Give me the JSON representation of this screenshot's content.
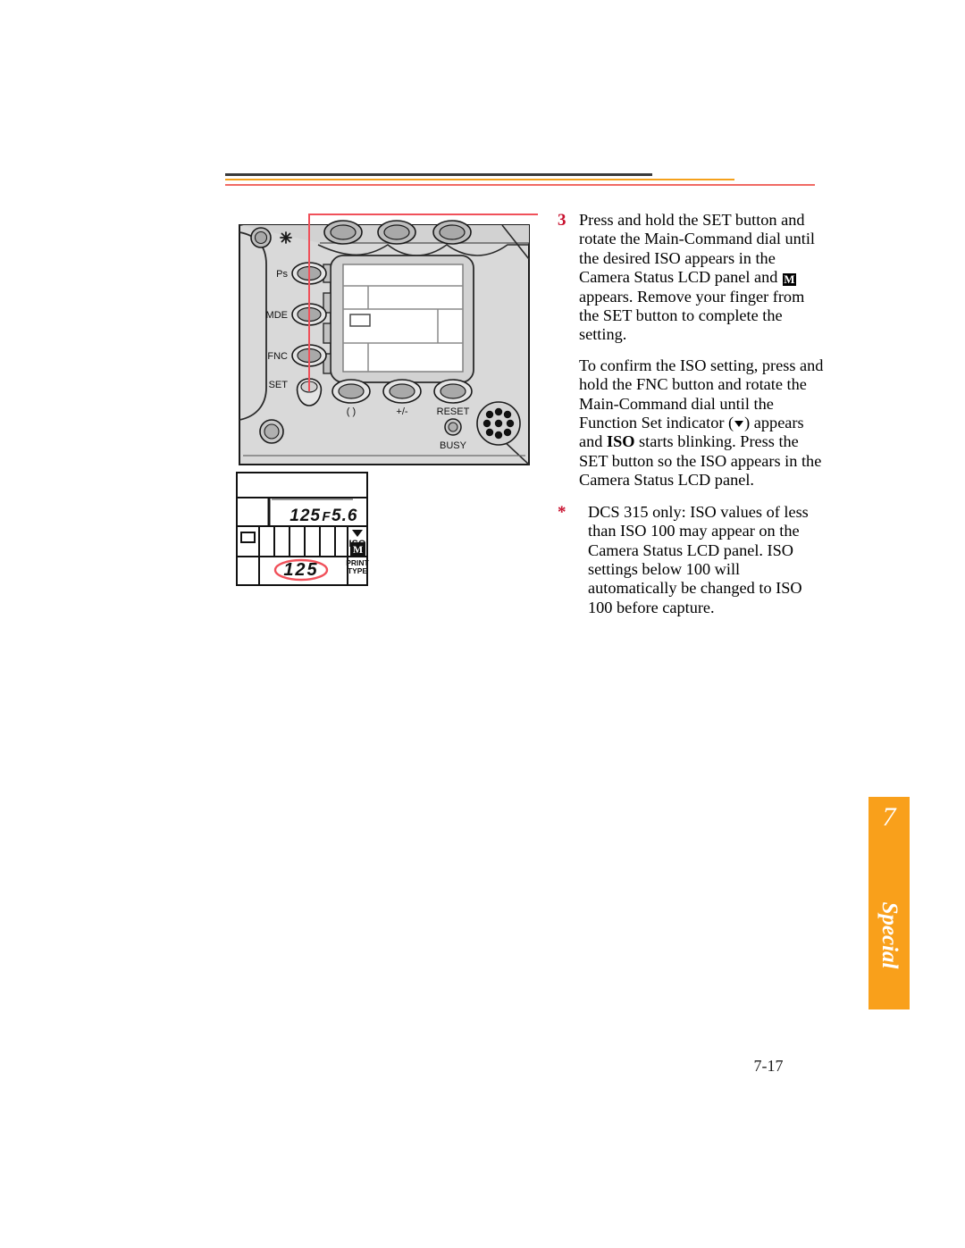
{
  "page": {
    "number": "7-17"
  },
  "side_tab": {
    "chapter_number": "7",
    "label": "Special",
    "color": "#f9a01b"
  },
  "header": {
    "rules": [
      {
        "name": "dark",
        "color": "#3a3a3a"
      },
      {
        "name": "orange",
        "color": "#f5a11b"
      },
      {
        "name": "red",
        "color": "#f06a64"
      }
    ]
  },
  "steps": [
    {
      "number": "3",
      "text_before_icon": "Press and hold the SET button and rotate the Main-Command dial until the desired ISO appears in the Camera Status LCD panel and ",
      "icon": "M",
      "text_after_icon": " appears. Remove your finger from the SET button to complete the setting."
    }
  ],
  "paragraphs": {
    "confirm_part1": "To confirm the ISO setting, press and hold the FNC button and rotate the Main-Command dial until the Function Set indicator (",
    "confirm_part2": ") appears and ",
    "confirm_bold": "ISO",
    "confirm_part3": " starts blinking. Press the SET button so the ISO appears in the Camera Status LCD panel."
  },
  "note": {
    "bullet": "*",
    "text": "DCS 315 only: ISO values of less than ISO 100 may appear on the Camera Status LCD panel. ISO settings below 100 will automatically be changed to ISO 100 before capture."
  },
  "camera": {
    "buttons_left": [
      {
        "label": "Ps"
      },
      {
        "label": "MDE"
      },
      {
        "label": "FNC"
      },
      {
        "label": "SET"
      }
    ],
    "buttons_bottom": [
      {
        "label": "( )"
      },
      {
        "label": "+/-"
      },
      {
        "label": "RESET"
      }
    ],
    "indicator_label": "BUSY",
    "body_color": "#d9d9d9",
    "button_fill": "#aeaeae",
    "callout_color": "#f0505a"
  },
  "lcd_detail": {
    "shutter_value": "125",
    "aperture_prefix": "F",
    "aperture_value": "5.6",
    "iso_label": "ISO",
    "mode_label": "M",
    "print_type_line1": "PRINT",
    "print_type_line2": "TYPE",
    "highlighted_value": "125",
    "highlight_color": "#f0505a"
  }
}
